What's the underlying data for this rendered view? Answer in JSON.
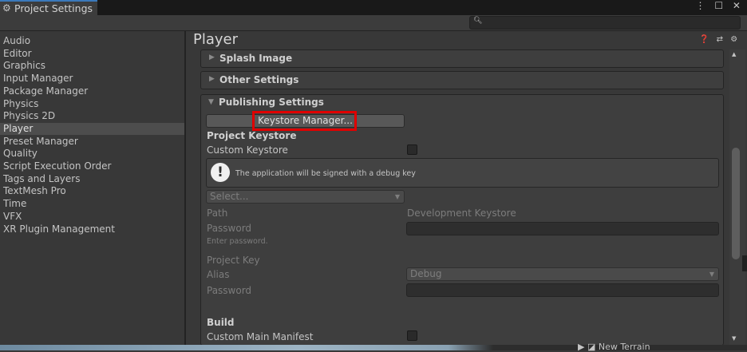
{
  "window": {
    "tab_title": "Project Settings",
    "controls": "⋮ ☐ ✕"
  },
  "search": {
    "placeholder": ""
  },
  "sidebar": {
    "items": [
      {
        "label": "Audio",
        "selected": false
      },
      {
        "label": "Editor",
        "selected": false
      },
      {
        "label": "Graphics",
        "selected": false
      },
      {
        "label": "Input Manager",
        "selected": false
      },
      {
        "label": "Package Manager",
        "selected": false
      },
      {
        "label": "Physics",
        "selected": false
      },
      {
        "label": "Physics 2D",
        "selected": false
      },
      {
        "label": "Player",
        "selected": true
      },
      {
        "label": "Preset Manager",
        "selected": false
      },
      {
        "label": "Quality",
        "selected": false
      },
      {
        "label": "Script Execution Order",
        "selected": false
      },
      {
        "label": "Tags and Layers",
        "selected": false
      },
      {
        "label": "TextMesh Pro",
        "selected": false
      },
      {
        "label": "Time",
        "selected": false
      },
      {
        "label": "VFX",
        "selected": false
      },
      {
        "label": "XR Plugin Management",
        "selected": false
      }
    ]
  },
  "main": {
    "title": "Player",
    "header_icons": "❓ ⇄ ⚙",
    "sections": {
      "splash": "Splash Image",
      "other": "Other Settings",
      "publishing": "Publishing Settings"
    },
    "publishing": {
      "keystore_manager_button": "Keystore Manager...",
      "project_keystore_heading": "Project Keystore",
      "custom_keystore_label": "Custom Keystore",
      "custom_keystore_checked": false,
      "info_message": "The application will be signed with a debug key",
      "select_dropdown": "Select...",
      "path_label": "Path",
      "path_value": "Development Keystore",
      "password_label": "Password",
      "password_hint": "Enter password.",
      "project_key_heading": "Project Key",
      "alias_label": "Alias",
      "alias_value": "Debug",
      "key_password_label": "Password",
      "build_heading": "Build",
      "custom_main_manifest_label": "Custom Main Manifest",
      "custom_main_manifest_checked": false
    }
  },
  "background": {
    "hierarchy_item": "▶ ◪ New Terrain"
  },
  "colors": {
    "highlight": "#e00000",
    "accent": "#3a79bb"
  }
}
